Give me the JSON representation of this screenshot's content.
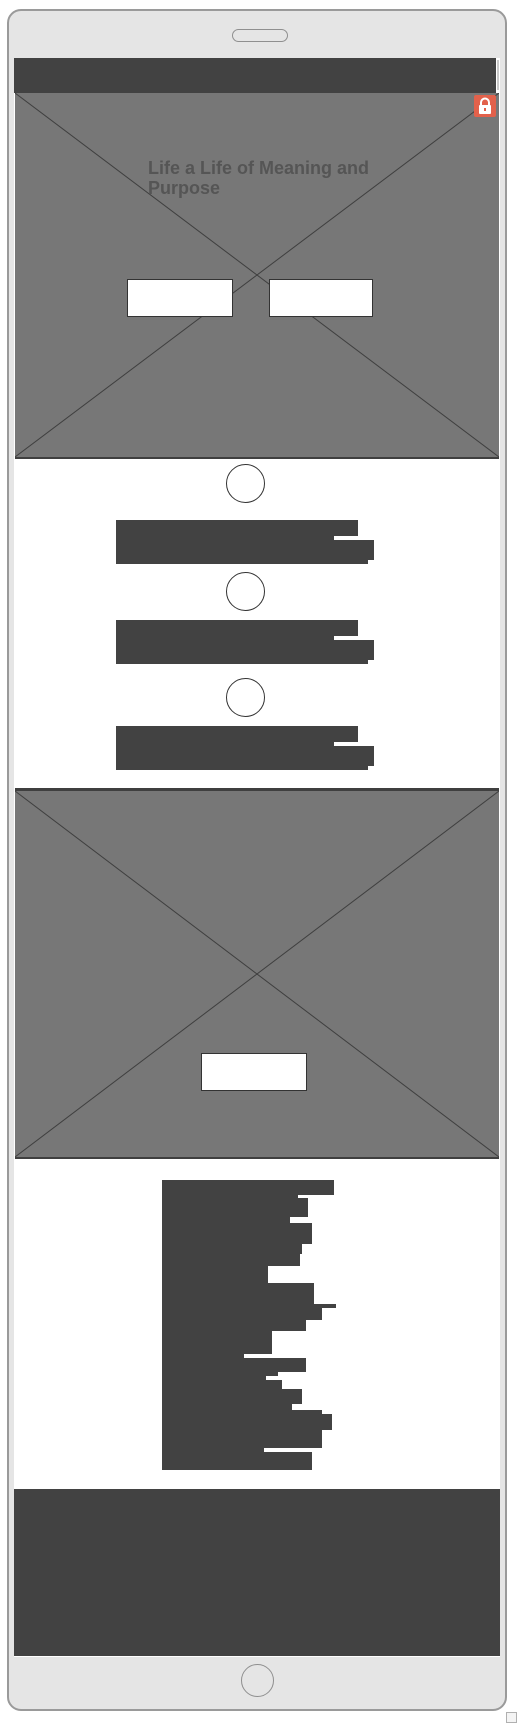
{
  "hero": {
    "title": "Life a Life of Meaning and Purpose",
    "buttons": [
      "",
      ""
    ],
    "lock_icon": "lock-icon",
    "badge_color": "#e2614b"
  },
  "features": {
    "items": [
      {
        "icon": "circle-icon"
      },
      {
        "icon": "circle-icon"
      },
      {
        "icon": "circle-icon"
      }
    ]
  },
  "banner": {
    "button": ""
  },
  "colors": {
    "dark": "#424242",
    "image_placeholder": "#777777",
    "device_frame": "#e5e5e5",
    "lock_badge": "#e2614b"
  }
}
